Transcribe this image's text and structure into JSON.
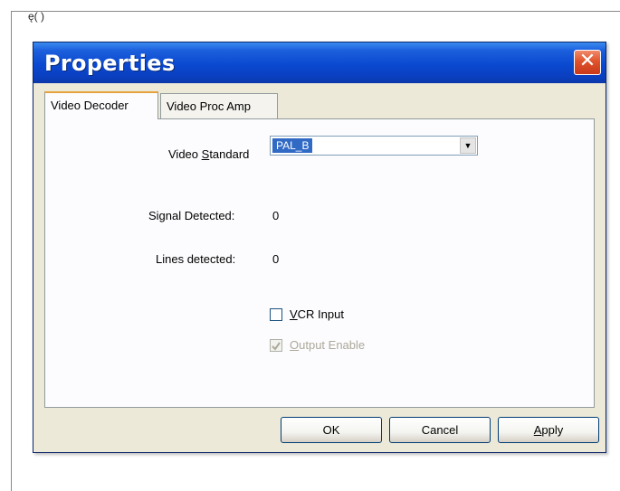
{
  "page": {
    "corner_text": "ę(  )"
  },
  "window": {
    "title": "Properties",
    "close_glyph": "✕"
  },
  "tabs": [
    {
      "label": "Video Decoder",
      "active": true
    },
    {
      "label": "Video Proc Amp",
      "active": false
    }
  ],
  "form": {
    "video_standard": {
      "label_prefix": "Video ",
      "label_mnemonic": "S",
      "label_suffix": "tandard",
      "value": "PAL_B"
    },
    "signal_detected": {
      "label": "Signal Detected:",
      "value": "0"
    },
    "lines_detected": {
      "label": "Lines detected:",
      "value": "0"
    },
    "vcr_input": {
      "mnemonic": "V",
      "rest": "CR Input",
      "checked": false
    },
    "output_enable": {
      "mnemonic": "O",
      "rest": "utput Enable",
      "checked": true,
      "enabled": false
    }
  },
  "buttons": {
    "ok": "OK",
    "cancel": "Cancel",
    "apply_mnemonic": "A",
    "apply_rest": "pply"
  },
  "colors": {
    "titlebar": "#0a49d1",
    "close": "#e0542c",
    "selection": "#316ac5",
    "dialog_bg": "#ece9d8"
  }
}
